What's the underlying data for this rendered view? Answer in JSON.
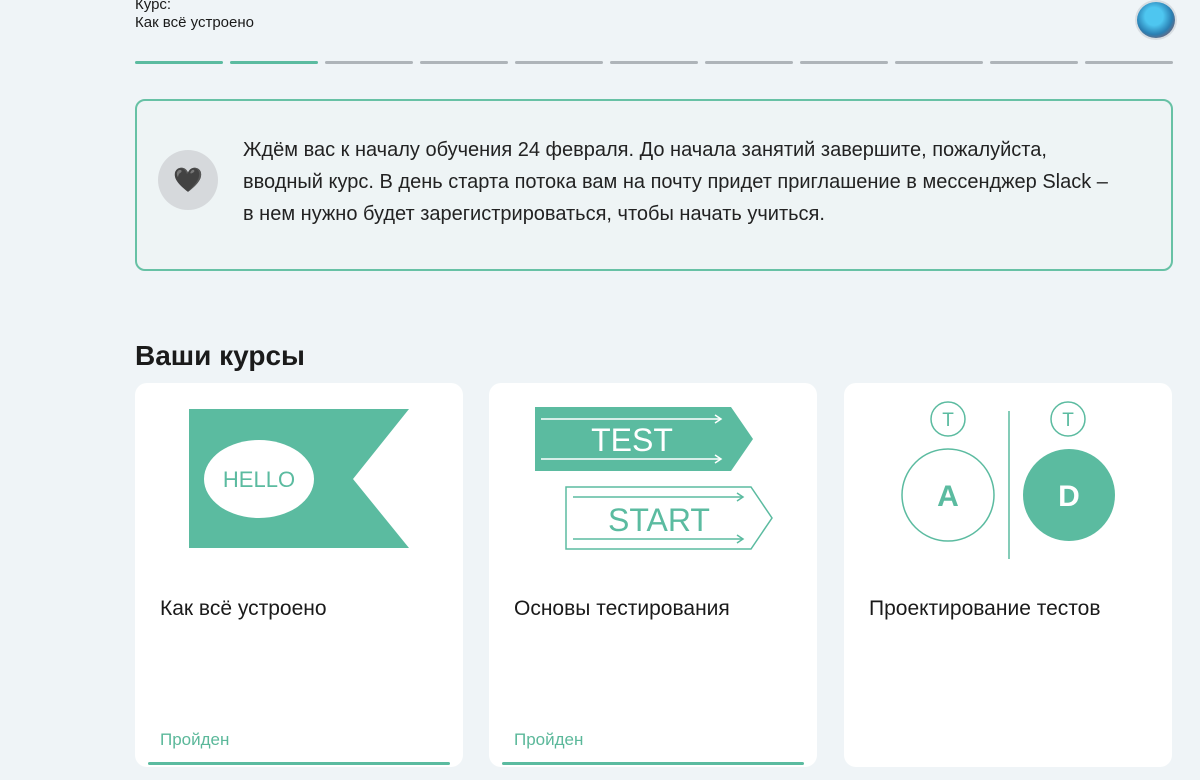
{
  "header": {
    "course_label": "Курс:",
    "course_name": "Как всё устроено",
    "progress": {
      "total_segments": 11,
      "completed_segments": 2
    }
  },
  "notice": {
    "icon": "heart-icon",
    "text": "Ждём вас к началу обучения 24 февраля. До начала занятий завершите, пожалуйста, вводный курс. В день старта потока вам на почту придет приглашение в мессенджер Slack – в нем нужно будет зарегистрироваться, чтобы начать учиться."
  },
  "courses_section": {
    "title": "Ваши курсы",
    "cards": [
      {
        "title": "Как всё устроено",
        "status": "Пройден",
        "art_text": [
          "HELLO"
        ]
      },
      {
        "title": "Основы тестирования",
        "status": "Пройден",
        "art_text": [
          "TEST",
          "START"
        ]
      },
      {
        "title": "Проектирование тестов",
        "status": "",
        "art_text": [
          "T",
          "T",
          "A",
          "D"
        ]
      }
    ]
  },
  "colors": {
    "accent": "#5bbba0",
    "background": "#eff4f7",
    "card": "#ffffff",
    "status_text": "#5bb89a"
  }
}
